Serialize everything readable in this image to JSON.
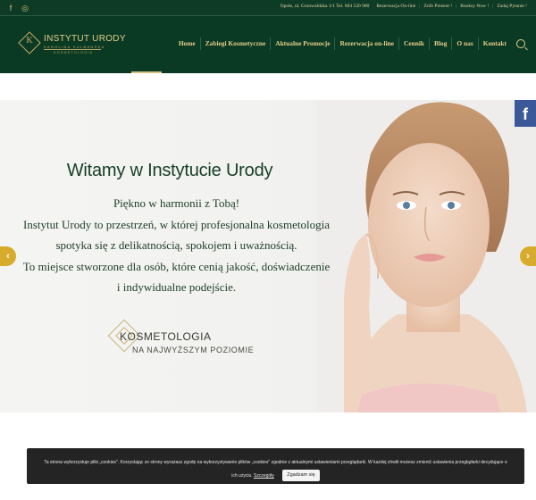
{
  "topbar": {
    "social": [
      {
        "icon": "facebook-icon",
        "glyph": "f"
      },
      {
        "icon": "instagram-icon",
        "glyph": "◎"
      }
    ],
    "links": [
      "Opole, ul. Grunwaldzka 1/1 Tel. 604 520 980",
      "Rezerwacja On-line",
      "Zrób Prezent !",
      "Booksy Now !",
      "Zadaj Pytanie !"
    ]
  },
  "logo": {
    "letter": "K",
    "name": "INSTYTUT URODY",
    "sub": "KAROLINA KULBANSKA",
    "sub2": "KOSMETOLOGIA"
  },
  "nav": {
    "items": [
      "Home",
      "Zabiegi Kosmetyczne",
      "Aktualne Promocje",
      "Rezerwacja on-line",
      "Cennik",
      "Blog",
      "O nas",
      "Kontakt"
    ]
  },
  "hero": {
    "title": "Witamy w Instytucie Urody",
    "lines": [
      "Piękno w harmonii z Tobą!",
      "Instytut Urody to przestrzeń, w której profesjonalna kosmetologia",
      "spotyka się z delikatnością, spokojem i uważnością.",
      "To miejsce stworzone dla osób, które cenią jakość, doświadczenie",
      "i indywidualne podejście."
    ],
    "tag_line1": "KOSMETOLOGIA",
    "tag_line2": "NA NAJWYŻSZYM POZIOMIE",
    "prev": "‹",
    "next": "›"
  },
  "fb_float": "f",
  "cookie": {
    "text": "Ta strona wykorzystuje pliki „cookies\". Korzystając ze strony wyrażasz zgodę na wykorzystywanie plików „cookies\" zgodnie z aktualnymi ustawieniami przeglądarki. W każdej chwili możesz zmienić ustawienia przeglądarki decydujące o ich użyciu.",
    "more": "Szczegóły",
    "accept": "Zgadzam się"
  },
  "colors": {
    "header_bg": "#0b3a24",
    "gold": "#e3cd8a",
    "arrow": "#d7ab2c",
    "facebook": "#3b5998"
  }
}
